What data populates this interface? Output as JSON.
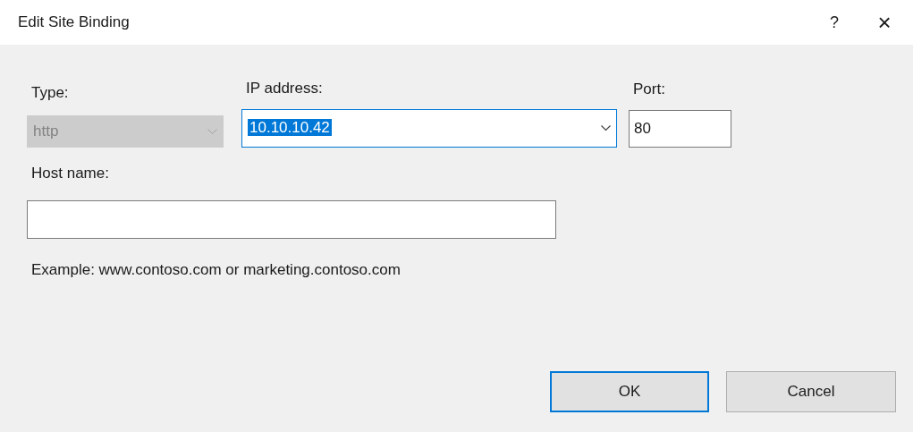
{
  "window": {
    "title": "Edit Site Binding",
    "help": "?",
    "close": "×"
  },
  "type": {
    "label": "Type:",
    "value": "http",
    "disabled": true
  },
  "ip_address": {
    "label": "IP address:",
    "value": "10.10.10.42",
    "focused": true,
    "text_selected": true
  },
  "port": {
    "label": "Port:",
    "value": "80"
  },
  "host_name": {
    "label": "Host name:"
  },
  "example": "Example: www.contoso.com or marketing.contoso.com",
  "buttons": [
    {
      "label": "OK",
      "default": true
    },
    {
      "label": "Cancel",
      "default": false
    }
  ]
}
